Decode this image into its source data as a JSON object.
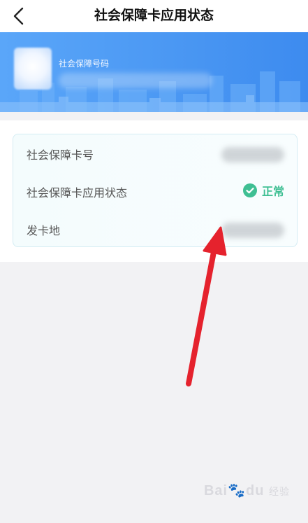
{
  "header": {
    "title": "社会保障卡应用状态",
    "back_icon": "chevron-left-icon"
  },
  "banner": {
    "label": "社会保障号码",
    "colors": {
      "start": "#5aa6f9",
      "end": "#3d8bef"
    }
  },
  "card": {
    "rows": [
      {
        "label": "社会保障卡号"
      },
      {
        "label": "社会保障卡应用状态",
        "status": "正常",
        "status_icon": "check-circle-icon",
        "status_color": "#3fbf93"
      },
      {
        "label": "发卡地"
      }
    ]
  },
  "annotation": {
    "color": "#e5222d",
    "icon": "red-arrow-annotation"
  },
  "watermark": {
    "brand": "Bai",
    "paw": "🐾",
    "suffix": "du",
    "cn": "经验"
  }
}
